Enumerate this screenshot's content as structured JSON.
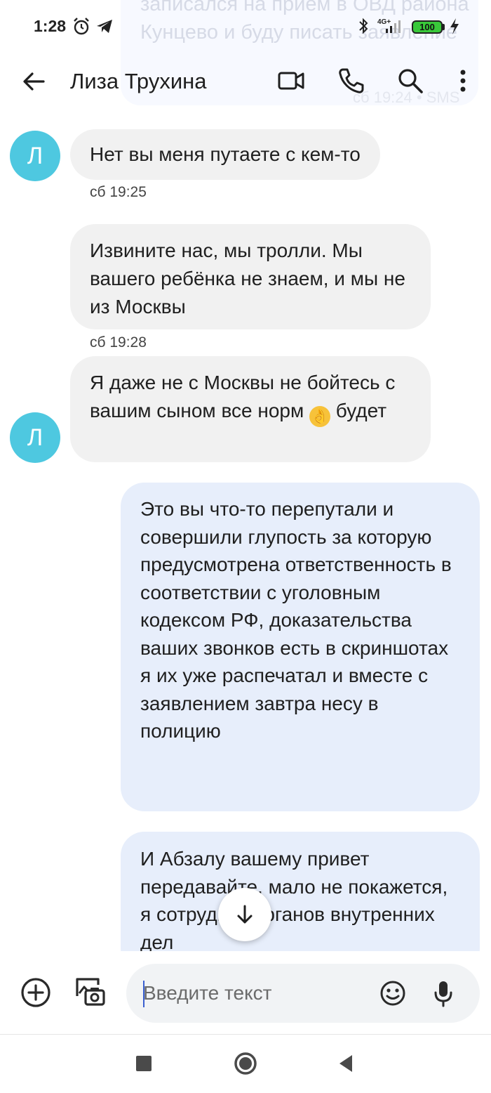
{
  "background_notification": {
    "text": "записался на приём в ОВД района Кунцево и буду писать заявление",
    "time": "сб 19:24 • SMS"
  },
  "status_bar": {
    "time": "1:28",
    "network": "4G+",
    "battery": "100"
  },
  "app_bar": {
    "contact_name": "Лиза Трухина"
  },
  "messages": [
    {
      "direction": "incoming",
      "avatar_letter": "Л",
      "text": "Нет вы меня путаете с кем-то",
      "meta": "сб 19:25"
    },
    {
      "direction": "incoming",
      "text": "Извините нас, мы тролли. Мы вашего ребёнка не знаем, и мы не из Москвы",
      "meta": "сб 19:28"
    },
    {
      "direction": "incoming",
      "avatar_letter": "Л",
      "text_before_emoji": "Я даже не с Москвы не бойтесь с вашим сыном все норм",
      "emoji": "👌",
      "text_after_emoji": "будет"
    },
    {
      "direction": "outgoing",
      "text": "Это вы что-то перепутали и совершили глупость за которую предусмотрена ответственность в соответствии с уголовным кодексом РФ, доказательства ваших звонков есть в скриншотах я их уже распечатал и вместе с заявлением завтра несу в полицию"
    },
    {
      "direction": "outgoing",
      "text": "И Абзалу вашему привет передавайте, мало не покажется, я сотрудник органов внутренних дел"
    }
  ],
  "compose": {
    "placeholder": "Введите текст"
  },
  "colors": {
    "avatar": "#4ec8e0",
    "incoming_bubble": "#f1f1f1",
    "outgoing_bubble": "#e7eefb",
    "battery": "#39c93a"
  },
  "icons": [
    "alarm-icon",
    "telegram-icon",
    "bluetooth-icon",
    "signal-icon",
    "battery-icon",
    "charging-icon",
    "back-arrow-icon",
    "video-call-icon",
    "phone-icon",
    "search-icon",
    "more-vert-icon",
    "scroll-down-icon",
    "add-icon",
    "gallery-icon",
    "emoji-icon",
    "mic-icon",
    "nav-recents-icon",
    "nav-home-icon",
    "nav-back-icon"
  ]
}
